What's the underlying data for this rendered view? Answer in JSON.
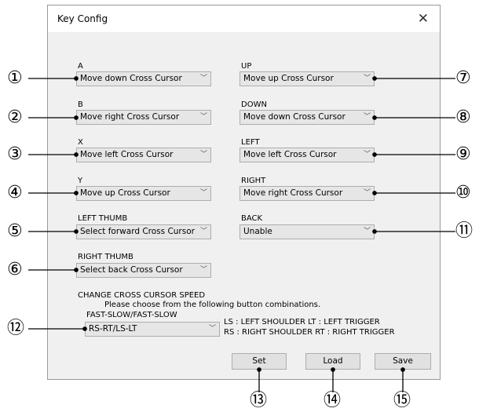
{
  "dialog": {
    "title": "Key Config",
    "close_glyph": "✕"
  },
  "left": [
    {
      "label": "A",
      "value": "Move down Cross Cursor"
    },
    {
      "label": "B",
      "value": "Move right Cross Cursor"
    },
    {
      "label": "X",
      "value": "Move left Cross Cursor"
    },
    {
      "label": "Y",
      "value": "Move up Cross Cursor"
    },
    {
      "label": "LEFT THUMB",
      "value": "Select forward Cross Cursor"
    },
    {
      "label": "RIGHT THUMB",
      "value": "Select back Cross Cursor"
    }
  ],
  "right": [
    {
      "label": "UP",
      "value": "Move up Cross Cursor"
    },
    {
      "label": "DOWN",
      "value": "Move down Cross Cursor"
    },
    {
      "label": "LEFT",
      "value": "Move left Cross Cursor"
    },
    {
      "label": "RIGHT",
      "value": "Move right Cross Cursor"
    },
    {
      "label": "BACK",
      "value": "Unable"
    }
  ],
  "speed": {
    "heading": "CHANGE CROSS CURSOR SPEED",
    "hint": "Please choose from the following button combinations.",
    "sublabel": "FAST-SLOW/FAST-SLOW",
    "value": "RS-RT/LS-LT",
    "legend1": "LS : LEFT SHOULDER   LT : LEFT TRIGGER",
    "legend2": "RS : RIGHT SHOULDER  RT : RIGHT TRIGGER"
  },
  "buttons": {
    "set": "Set",
    "load": "Load",
    "save": "Save"
  },
  "callouts": [
    "①",
    "②",
    "③",
    "④",
    "⑤",
    "⑥",
    "⑦",
    "⑧",
    "⑨",
    "⑩",
    "⑪",
    "⑫",
    "⑬",
    "⑭",
    "⑮"
  ],
  "icons": {
    "chevron": "chevron-down-icon",
    "close": "close-icon"
  }
}
